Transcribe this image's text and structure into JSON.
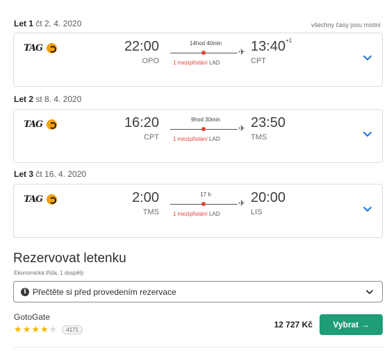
{
  "timezone_note": "všechny časy jsou místní",
  "flights": [
    {
      "label": "Let 1",
      "date": "čt 2. 4. 2020",
      "airline_logo": "TAG",
      "dep_time": "22:00",
      "dep_iata": "OPO",
      "duration": "14hod 40min",
      "stops": "1 mezipřistání",
      "stop_code": "LAD",
      "arr_time": "13:40",
      "arr_day_offset": "+1",
      "arr_iata": "CPT"
    },
    {
      "label": "Let 2",
      "date": "st 8. 4. 2020",
      "airline_logo": "TAG",
      "dep_time": "16:20",
      "dep_iata": "CPT",
      "duration": "9hod 30min",
      "stops": "1 mezipřistání",
      "stop_code": "LAD",
      "arr_time": "23:50",
      "arr_day_offset": "",
      "arr_iata": "TMS"
    },
    {
      "label": "Let 3",
      "date": "čt 16. 4. 2020",
      "airline_logo": "TAG",
      "dep_time": "2:00",
      "dep_iata": "TMS",
      "duration": "17 h",
      "stops": "1 mezipřistání",
      "stop_code": "LAD",
      "arr_time": "20:00",
      "arr_day_offset": "",
      "arr_iata": "LIS"
    }
  ],
  "booking": {
    "title": "Rezervovat letenku",
    "subtitle": "Ekonomická třída, 1 dospělý",
    "notice": "Přečtěte si před provedením rezervace",
    "agency": "GotoGate",
    "rating": 4,
    "rating_max": 5,
    "reviews": "4171",
    "price": "12 727 Kč",
    "select_label": "Vybrat →"
  },
  "colors": {
    "accent": "#1e9d77",
    "stop": "#e0433a",
    "star": "#f5b700",
    "chevron": "#1a73e8"
  }
}
